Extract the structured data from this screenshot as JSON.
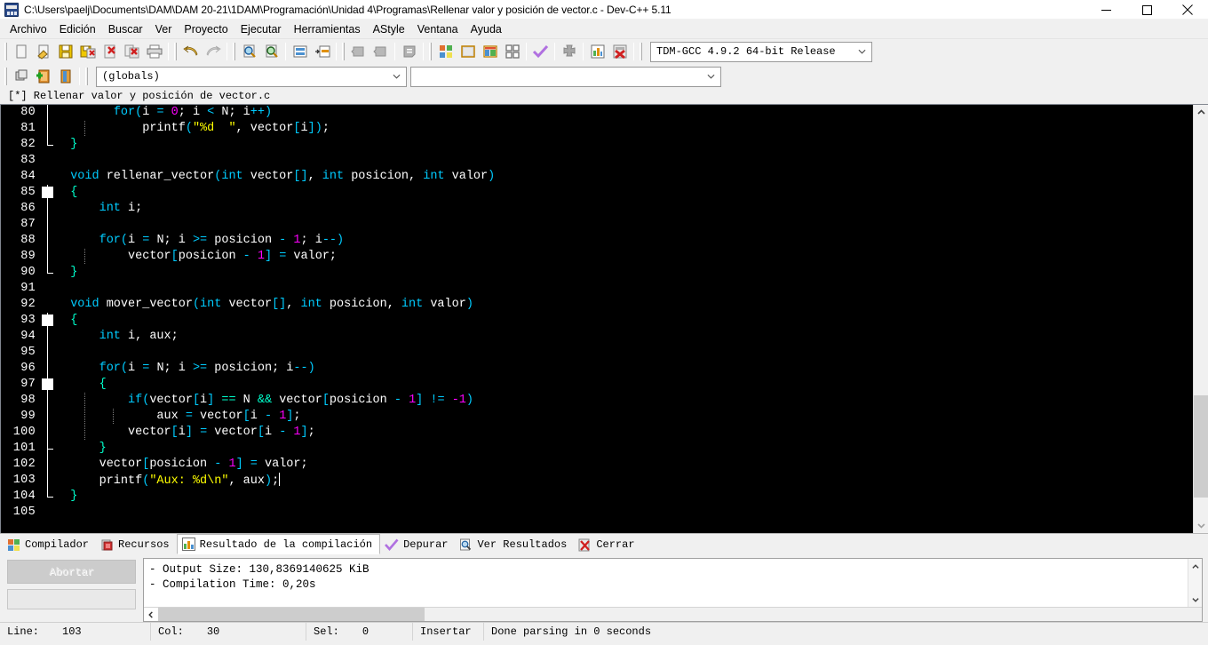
{
  "window": {
    "title": "C:\\Users\\paelj\\Documents\\DAM\\DAM 20-21\\1DAM\\Programación\\Unidad 4\\Programas\\Rellenar valor y posición de vector.c - Dev-C++ 5.11",
    "minimize_label": "minimize-icon",
    "maximize_label": "maximize-icon",
    "close_label": "close-icon",
    "app_icon": "devcpp-icon"
  },
  "menu": {
    "items": [
      {
        "label": "Archivo"
      },
      {
        "label": "Edición"
      },
      {
        "label": "Buscar"
      },
      {
        "label": "Ver"
      },
      {
        "label": "Proyecto"
      },
      {
        "label": "Ejecutar"
      },
      {
        "label": "Herramientas"
      },
      {
        "label": "AStyle"
      },
      {
        "label": "Ventana"
      },
      {
        "label": "Ayuda"
      }
    ]
  },
  "toolbar": {
    "compiler_combo_value": "TDM-GCC 4.9.2 64-bit Release",
    "class_combo_value": "(globals)",
    "member_combo_value": "",
    "icons": [
      "new-file-icon",
      "open-file-icon",
      "save-icon",
      "save-all-icon",
      "close-file-icon",
      "close-all-icon",
      "print-icon",
      "undo-icon",
      "redo-icon",
      "find-icon",
      "replace-icon",
      "goto-line-icon",
      "goto-function-icon",
      "indent-icon",
      "unindent-icon",
      "toggle-comment-icon",
      "compile-icon",
      "run-icon",
      "compile-run-icon",
      "rebuild-all-icon",
      "syntax-check-icon",
      "profile-icon",
      "debug-icon",
      "stop-execution-icon"
    ],
    "row2_icons": [
      "project-icon",
      "add-to-project-icon",
      "remove-from-project-icon"
    ]
  },
  "editor_tab": {
    "label": "[*] Rellenar valor y posición de vector.c"
  },
  "editor": {
    "first_line": 80,
    "lines": [
      {
        "n": 80,
        "fold": "v",
        "dots": 0,
        "tokens": [
          {
            "t": "        ",
            "c": "id"
          },
          {
            "t": "for",
            "c": "k"
          },
          {
            "t": "(",
            "c": "op"
          },
          {
            "t": "i ",
            "c": "id"
          },
          {
            "t": "=",
            "c": "op"
          },
          {
            "t": " ",
            "c": "id"
          },
          {
            "t": "0",
            "c": "num"
          },
          {
            "t": "; i ",
            "c": "id"
          },
          {
            "t": "<",
            "c": "op"
          },
          {
            "t": " N; i",
            "c": "id"
          },
          {
            "t": "++",
            "c": "op"
          },
          {
            "t": ")",
            "c": "op"
          }
        ]
      },
      {
        "n": 81,
        "fold": "v",
        "dots": 1,
        "tokens": [
          {
            "t": "            printf",
            "c": "id"
          },
          {
            "t": "(",
            "c": "op"
          },
          {
            "t": "\"%d  \"",
            "c": "str"
          },
          {
            "t": ",",
            "c": "id"
          },
          {
            "t": " vector",
            "c": "id"
          },
          {
            "t": "[",
            "c": "op"
          },
          {
            "t": "i",
            "c": "id"
          },
          {
            "t": "]",
            "c": "op"
          },
          {
            "t": ")",
            "c": "op"
          },
          {
            "t": ";",
            "c": "id"
          }
        ]
      },
      {
        "n": 82,
        "fold": "end",
        "dots": 0,
        "tokens": [
          {
            "t": "  ",
            "c": "id"
          },
          {
            "t": "}",
            "c": "gr"
          }
        ]
      },
      {
        "n": 83,
        "fold": "none",
        "dots": 0,
        "tokens": []
      },
      {
        "n": 84,
        "fold": "none",
        "dots": 0,
        "tokens": [
          {
            "t": "  ",
            "c": "id"
          },
          {
            "t": "void",
            "c": "k"
          },
          {
            "t": " rellenar_vector",
            "c": "id"
          },
          {
            "t": "(",
            "c": "op"
          },
          {
            "t": "int",
            "c": "k"
          },
          {
            "t": " vector",
            "c": "id"
          },
          {
            "t": "[]",
            "c": "op"
          },
          {
            "t": ", ",
            "c": "id"
          },
          {
            "t": "int",
            "c": "k"
          },
          {
            "t": " posicion, ",
            "c": "id"
          },
          {
            "t": "int",
            "c": "k"
          },
          {
            "t": " valor",
            "c": "id"
          },
          {
            "t": ")",
            "c": "op"
          }
        ]
      },
      {
        "n": 85,
        "fold": "box-start",
        "dots": 0,
        "tokens": [
          {
            "t": "  ",
            "c": "id"
          },
          {
            "t": "{",
            "c": "gr"
          }
        ]
      },
      {
        "n": 86,
        "fold": "v",
        "dots": 0,
        "tokens": [
          {
            "t": "      ",
            "c": "id"
          },
          {
            "t": "int",
            "c": "k"
          },
          {
            "t": " i;",
            "c": "id"
          }
        ]
      },
      {
        "n": 87,
        "fold": "v",
        "dots": 0,
        "tokens": []
      },
      {
        "n": 88,
        "fold": "v",
        "dots": 0,
        "tokens": [
          {
            "t": "      ",
            "c": "id"
          },
          {
            "t": "for",
            "c": "k"
          },
          {
            "t": "(",
            "c": "op"
          },
          {
            "t": "i ",
            "c": "id"
          },
          {
            "t": "=",
            "c": "op"
          },
          {
            "t": " N; i ",
            "c": "id"
          },
          {
            "t": ">=",
            "c": "op"
          },
          {
            "t": " posicion ",
            "c": "id"
          },
          {
            "t": "-",
            "c": "op"
          },
          {
            "t": " ",
            "c": "id"
          },
          {
            "t": "1",
            "c": "num"
          },
          {
            "t": "; i",
            "c": "id"
          },
          {
            "t": "--",
            "c": "op"
          },
          {
            "t": ")",
            "c": "op"
          }
        ]
      },
      {
        "n": 89,
        "fold": "v",
        "dots": 1,
        "tokens": [
          {
            "t": "          vector",
            "c": "id"
          },
          {
            "t": "[",
            "c": "op"
          },
          {
            "t": "posicion ",
            "c": "id"
          },
          {
            "t": "-",
            "c": "op"
          },
          {
            "t": " ",
            "c": "id"
          },
          {
            "t": "1",
            "c": "num"
          },
          {
            "t": "]",
            "c": "op"
          },
          {
            "t": " ",
            "c": "id"
          },
          {
            "t": "=",
            "c": "op"
          },
          {
            "t": " valor;",
            "c": "id"
          }
        ]
      },
      {
        "n": 90,
        "fold": "end",
        "dots": 0,
        "tokens": [
          {
            "t": "  ",
            "c": "id"
          },
          {
            "t": "}",
            "c": "gr"
          }
        ]
      },
      {
        "n": 91,
        "fold": "none",
        "dots": 0,
        "tokens": []
      },
      {
        "n": 92,
        "fold": "none",
        "dots": 0,
        "tokens": [
          {
            "t": "  ",
            "c": "id"
          },
          {
            "t": "void",
            "c": "k"
          },
          {
            "t": " mover_vector",
            "c": "id"
          },
          {
            "t": "(",
            "c": "op"
          },
          {
            "t": "int",
            "c": "k"
          },
          {
            "t": " vector",
            "c": "id"
          },
          {
            "t": "[]",
            "c": "op"
          },
          {
            "t": ", ",
            "c": "id"
          },
          {
            "t": "int",
            "c": "k"
          },
          {
            "t": " posicion, ",
            "c": "id"
          },
          {
            "t": "int",
            "c": "k"
          },
          {
            "t": " valor",
            "c": "id"
          },
          {
            "t": ")",
            "c": "op"
          }
        ]
      },
      {
        "n": 93,
        "fold": "box-start",
        "dots": 0,
        "tokens": [
          {
            "t": "  ",
            "c": "id"
          },
          {
            "t": "{",
            "c": "gr"
          }
        ]
      },
      {
        "n": 94,
        "fold": "v",
        "dots": 0,
        "tokens": [
          {
            "t": "      ",
            "c": "id"
          },
          {
            "t": "int",
            "c": "k"
          },
          {
            "t": " i, aux;",
            "c": "id"
          }
        ]
      },
      {
        "n": 95,
        "fold": "v",
        "dots": 0,
        "tokens": []
      },
      {
        "n": 96,
        "fold": "v",
        "dots": 0,
        "tokens": [
          {
            "t": "      ",
            "c": "id"
          },
          {
            "t": "for",
            "c": "k"
          },
          {
            "t": "(",
            "c": "op"
          },
          {
            "t": "i ",
            "c": "id"
          },
          {
            "t": "=",
            "c": "op"
          },
          {
            "t": " N; i ",
            "c": "id"
          },
          {
            "t": ">=",
            "c": "op"
          },
          {
            "t": " posicion; i",
            "c": "id"
          },
          {
            "t": "--",
            "c": "op"
          },
          {
            "t": ")",
            "c": "op"
          }
        ]
      },
      {
        "n": 97,
        "fold": "box-mid",
        "dots": 0,
        "tokens": [
          {
            "t": "      ",
            "c": "id"
          },
          {
            "t": "{",
            "c": "gr"
          }
        ]
      },
      {
        "n": 98,
        "fold": "v",
        "dots": 1,
        "tokens": [
          {
            "t": "          ",
            "c": "id"
          },
          {
            "t": "if",
            "c": "k"
          },
          {
            "t": "(",
            "c": "op"
          },
          {
            "t": "vector",
            "c": "id"
          },
          {
            "t": "[",
            "c": "op"
          },
          {
            "t": "i",
            "c": "id"
          },
          {
            "t": "]",
            "c": "op"
          },
          {
            "t": " ",
            "c": "id"
          },
          {
            "t": "==",
            "c": "gr"
          },
          {
            "t": " N ",
            "c": "id"
          },
          {
            "t": "&&",
            "c": "gr"
          },
          {
            "t": " vector",
            "c": "id"
          },
          {
            "t": "[",
            "c": "op"
          },
          {
            "t": "posicion ",
            "c": "id"
          },
          {
            "t": "-",
            "c": "op"
          },
          {
            "t": " ",
            "c": "id"
          },
          {
            "t": "1",
            "c": "num"
          },
          {
            "t": "]",
            "c": "op"
          },
          {
            "t": " ",
            "c": "id"
          },
          {
            "t": "!=",
            "c": "op"
          },
          {
            "t": " ",
            "c": "id"
          },
          {
            "t": "-1",
            "c": "num"
          },
          {
            "t": ")",
            "c": "op"
          }
        ]
      },
      {
        "n": 99,
        "fold": "v",
        "dots": 2,
        "tokens": [
          {
            "t": "              aux ",
            "c": "id"
          },
          {
            "t": "=",
            "c": "op"
          },
          {
            "t": " vector",
            "c": "id"
          },
          {
            "t": "[",
            "c": "op"
          },
          {
            "t": "i ",
            "c": "id"
          },
          {
            "t": "-",
            "c": "op"
          },
          {
            "t": " ",
            "c": "id"
          },
          {
            "t": "1",
            "c": "num"
          },
          {
            "t": "]",
            "c": "op"
          },
          {
            "t": ";",
            "c": "id"
          }
        ]
      },
      {
        "n": 100,
        "fold": "v",
        "dots": 1,
        "tokens": [
          {
            "t": "          vector",
            "c": "id"
          },
          {
            "t": "[",
            "c": "op"
          },
          {
            "t": "i",
            "c": "id"
          },
          {
            "t": "]",
            "c": "op"
          },
          {
            "t": " ",
            "c": "id"
          },
          {
            "t": "=",
            "c": "op"
          },
          {
            "t": " vector",
            "c": "id"
          },
          {
            "t": "[",
            "c": "op"
          },
          {
            "t": "i ",
            "c": "id"
          },
          {
            "t": "-",
            "c": "op"
          },
          {
            "t": " ",
            "c": "id"
          },
          {
            "t": "1",
            "c": "num"
          },
          {
            "t": "]",
            "c": "op"
          },
          {
            "t": ";",
            "c": "id"
          }
        ]
      },
      {
        "n": 101,
        "fold": "mid-end",
        "dots": 0,
        "tokens": [
          {
            "t": "      ",
            "c": "id"
          },
          {
            "t": "}",
            "c": "gr"
          }
        ]
      },
      {
        "n": 102,
        "fold": "v",
        "dots": 0,
        "tokens": [
          {
            "t": "      vector",
            "c": "id"
          },
          {
            "t": "[",
            "c": "op"
          },
          {
            "t": "posicion ",
            "c": "id"
          },
          {
            "t": "-",
            "c": "op"
          },
          {
            "t": " ",
            "c": "id"
          },
          {
            "t": "1",
            "c": "num"
          },
          {
            "t": "]",
            "c": "op"
          },
          {
            "t": " ",
            "c": "id"
          },
          {
            "t": "=",
            "c": "op"
          },
          {
            "t": " valor;",
            "c": "id"
          }
        ]
      },
      {
        "n": 103,
        "fold": "v",
        "dots": 0,
        "caret": true,
        "tokens": [
          {
            "t": "      printf",
            "c": "id"
          },
          {
            "t": "(",
            "c": "op"
          },
          {
            "t": "\"Aux: %d\\n\"",
            "c": "str"
          },
          {
            "t": ", aux",
            "c": "id"
          },
          {
            "t": ")",
            "c": "op"
          },
          {
            "t": ";",
            "c": "id"
          }
        ]
      },
      {
        "n": 104,
        "fold": "end",
        "dots": 0,
        "tokens": [
          {
            "t": "  ",
            "c": "id"
          },
          {
            "t": "}",
            "c": "gr"
          }
        ]
      },
      {
        "n": 105,
        "fold": "none",
        "dots": 0,
        "tokens": []
      }
    ]
  },
  "bottom_panel": {
    "tabs": [
      {
        "label": "Compilador",
        "icon": "compiler-icon",
        "active": false
      },
      {
        "label": "Recursos",
        "icon": "resources-icon",
        "active": false
      },
      {
        "label": "Resultado de la compilación",
        "icon": "build-log-icon",
        "active": true
      },
      {
        "label": "Depurar",
        "icon": "debug-check-icon",
        "active": false
      },
      {
        "label": "Ver Resultados",
        "icon": "find-results-icon",
        "active": false
      },
      {
        "label": "Cerrar",
        "icon": "close-panel-icon",
        "active": false
      }
    ],
    "abort_button": "Abortar",
    "log_lines": [
      "- Output Size: 130,8369140625 KiB",
      "- Compilation Time: 0,20s"
    ]
  },
  "statusbar": {
    "line_label": "Line:",
    "line_value": "103",
    "col_label": "Col:",
    "col_value": "30",
    "sel_label": "Sel:",
    "sel_value": "0",
    "mode": "Insertar",
    "message": "Done parsing in 0 seconds"
  },
  "colors": {
    "editor_bg": "#000000",
    "keyword": "#00ccff",
    "number": "#ff00ff",
    "string": "#ffff00",
    "identifier": "#ffffff",
    "chrome": "#f0f0f0"
  }
}
